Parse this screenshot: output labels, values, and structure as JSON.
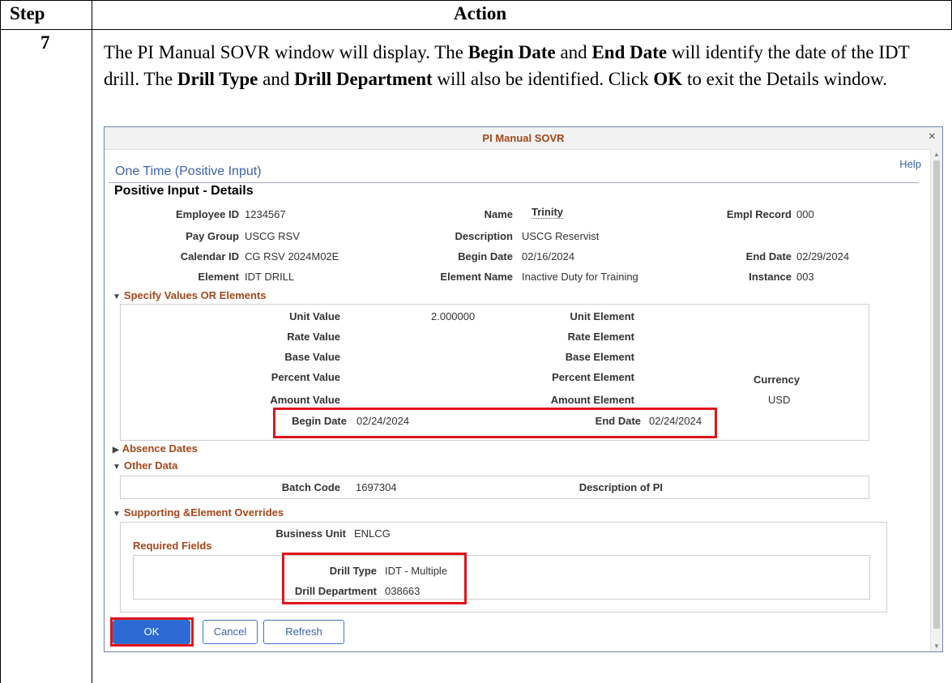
{
  "table": {
    "header_step": "Step",
    "header_action": "Action",
    "step_number": "7",
    "instruction": {
      "p1": "The PI Manual SOVR window will display. The ",
      "b1": "Begin Date",
      "p2": " and ",
      "b2": "End Date",
      "p3": " will identify the date of the IDT drill. The ",
      "b3": "Drill Type",
      "p4": " and ",
      "b4": "Drill Department",
      "p5": " will also be identified. Click ",
      "b5": "OK",
      "p6": " to exit the Details window."
    }
  },
  "dialog": {
    "title": "PI Manual SOVR",
    "close_glyph": "×",
    "help": "Help",
    "subtitle": "One Time (Positive Input)",
    "section_title": "Positive Input - Details",
    "header_fields": {
      "employee_id_label": "Employee ID",
      "employee_id": "1234567",
      "name_label": "Name",
      "name": "Trinity",
      "empl_record_label": "Empl Record",
      "empl_record": "000",
      "pay_group_label": "Pay Group",
      "pay_group": "USCG RSV",
      "description_label": "Description",
      "description": "USCG Reservist",
      "calendar_id_label": "Calendar ID",
      "calendar_id": "CG RSV 2024M02E",
      "begin_date_label": "Begin Date",
      "begin_date": "02/16/2024",
      "end_date_label": "End Date",
      "end_date": "02/29/2024",
      "element_label": "Element",
      "element": "IDT DRILL",
      "element_name_label": "Element Name",
      "element_name": "Inactive Duty for Training",
      "instance_label": "Instance",
      "instance": "003"
    },
    "specify_values": {
      "header": "Specify Values OR Elements",
      "unit_value_label": "Unit Value",
      "unit_value": "2.000000",
      "unit_element_label": "Unit Element",
      "rate_value_label": "Rate Value",
      "rate_element_label": "Rate Element",
      "base_value_label": "Base Value",
      "base_element_label": "Base Element",
      "percent_value_label": "Percent Value",
      "percent_element_label": "Percent Element",
      "currency_label": "Currency",
      "amount_value_label": "Amount Value",
      "amount_element_label": "Amount Element",
      "currency": "USD",
      "begin_date_label": "Begin Date",
      "begin_date": "02/24/2024",
      "end_date_label": "End Date",
      "end_date": "02/24/2024"
    },
    "absence_dates": {
      "header": "Absence Dates"
    },
    "other_data": {
      "header": "Other Data",
      "batch_code_label": "Batch Code",
      "batch_code": "1697304",
      "description_of_pi_label": "Description of PI"
    },
    "supporting": {
      "header": "Supporting &Element Overrides",
      "business_unit_label": "Business Unit",
      "business_unit": "ENLCG",
      "required_fields": "Required Fields",
      "drill_type_label": "Drill Type",
      "drill_type": "IDT - Multiple",
      "drill_department_label": "Drill Department",
      "drill_department": "038663"
    },
    "buttons": {
      "ok": "OK",
      "cancel": "Cancel",
      "refresh": "Refresh"
    },
    "colors": {
      "accent_link": "#3864a8",
      "group_header": "#a4471a",
      "highlight": "#e2141b",
      "primary_button": "#2d6ad3"
    }
  }
}
